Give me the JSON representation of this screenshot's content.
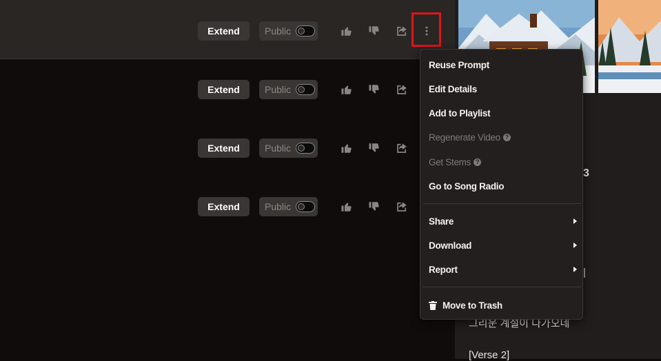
{
  "rows": [
    {
      "extend_label": "Extend",
      "public_label": "Public"
    },
    {
      "extend_label": "Extend",
      "public_label": "Public"
    },
    {
      "extend_label": "Extend",
      "public_label": "Public"
    },
    {
      "extend_label": "Extend",
      "public_label": "Public"
    }
  ],
  "icons": {
    "like": "thumbs-up-icon",
    "dislike": "thumbs-down-icon",
    "share": "share-icon",
    "more": "more-vertical-icon"
  },
  "menu": {
    "reuse_prompt": "Reuse Prompt",
    "edit_details": "Edit Details",
    "add_to_playlist": "Add to Playlist",
    "regenerate_video": "Regenerate Video",
    "get_stems": "Get Stems",
    "go_to_song_radio": "Go to Song Radio",
    "share": "Share",
    "download": "Download",
    "report": "Report",
    "move_to_trash": "Move to Trash"
  },
  "side_panel": {
    "lyric_fragment_1": "3",
    "lyric_fragment_2": "|",
    "lyric_line": "그리운 계절이 다가오네",
    "verse_label": "[Verse 2]"
  },
  "colors": {
    "highlight": "#e0141a",
    "menu_bg": "#231f1e",
    "row_active": "#2a2624"
  }
}
